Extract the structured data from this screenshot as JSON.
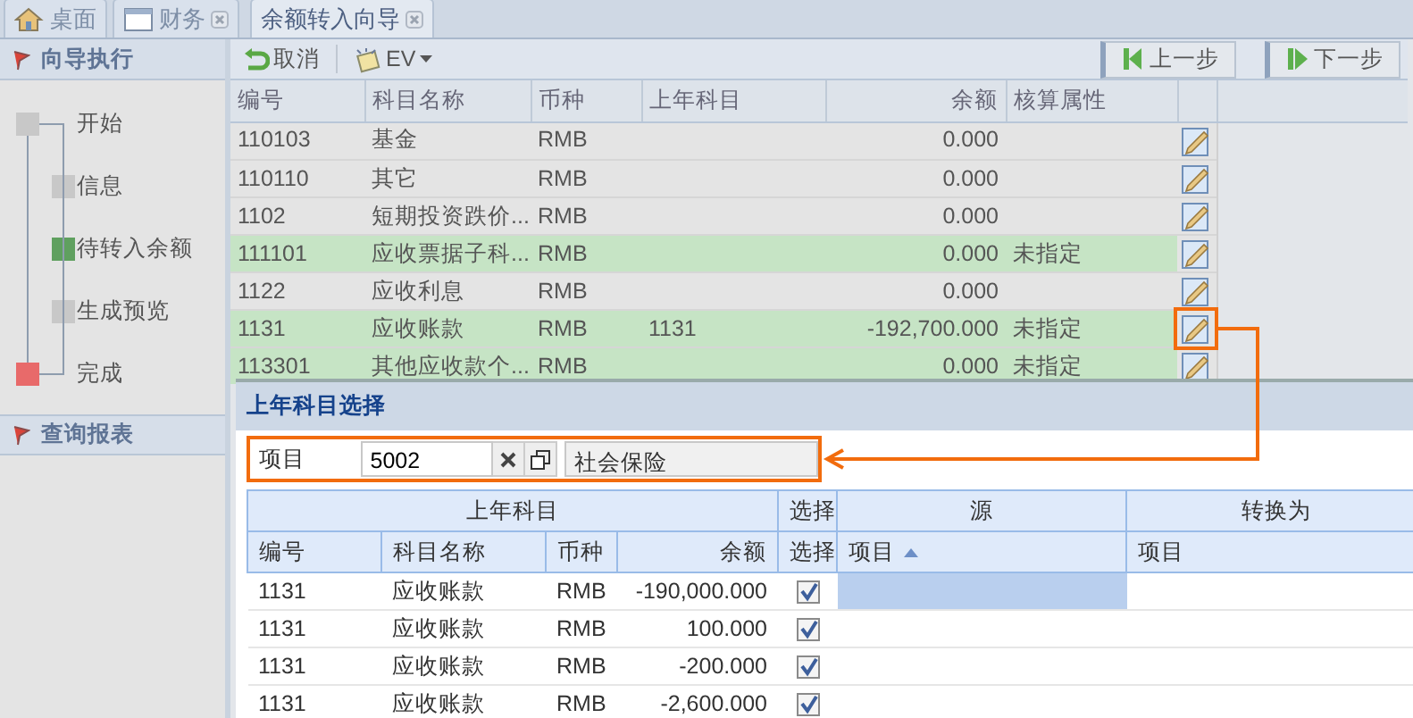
{
  "tabs": [
    {
      "label": "桌面",
      "kind": "desktop",
      "closable": false,
      "selected": false
    },
    {
      "label": "财务",
      "kind": "module",
      "closable": true,
      "selected": false
    },
    {
      "label": "余额转入向导",
      "kind": "wizard",
      "closable": true,
      "selected": true
    }
  ],
  "wizard_panel": {
    "title": "向导执行",
    "steps": [
      {
        "label": "开始",
        "color": "#c8c8c8",
        "children": [
          {
            "label": "信息",
            "color": "#c8c8c8"
          },
          {
            "label": "待转入余额",
            "color": "#5fa05f"
          },
          {
            "label": "生成预览",
            "color": "#c8c8c8"
          }
        ]
      },
      {
        "label": "完成",
        "color": "#e86a6a"
      }
    ]
  },
  "report_panel": {
    "title": "查询报表"
  },
  "toolbar": {
    "cancel": "取消",
    "ev": "EV",
    "prev": "上一步",
    "next": "下一步"
  },
  "grid": {
    "columns": [
      "编号",
      "科目名称",
      "币种",
      "上年科目",
      "余额",
      "核算属性"
    ],
    "rows": [
      {
        "code": "110103",
        "name": "基金",
        "currency": "RMB",
        "prev_account": "",
        "balance": "0.000",
        "attribute": "",
        "highlighted": false,
        "marked": false
      },
      {
        "code": "110110",
        "name": "其它",
        "currency": "RMB",
        "prev_account": "",
        "balance": "0.000",
        "attribute": "",
        "highlighted": false,
        "marked": false
      },
      {
        "code": "1102",
        "name": "短期投资跌价...",
        "currency": "RMB",
        "prev_account": "",
        "balance": "0.000",
        "attribute": "",
        "highlighted": false,
        "marked": false
      },
      {
        "code": "111101",
        "name": "应收票据子科...",
        "currency": "RMB",
        "prev_account": "",
        "balance": "0.000",
        "attribute": "未指定",
        "highlighted": true,
        "marked": false
      },
      {
        "code": "1122",
        "name": "应收利息",
        "currency": "RMB",
        "prev_account": "",
        "balance": "0.000",
        "attribute": "",
        "highlighted": false,
        "marked": false
      },
      {
        "code": "1131",
        "name": "应收账款",
        "currency": "RMB",
        "prev_account": "1131",
        "balance": "-192,700.000",
        "attribute": "未指定",
        "highlighted": true,
        "marked": true
      },
      {
        "code": "113301",
        "name": "其他应收款个...",
        "currency": "RMB",
        "prev_account": "",
        "balance": "0.000",
        "attribute": "未指定",
        "highlighted": true,
        "marked": false
      }
    ]
  },
  "dialog": {
    "title": "上年科目选择",
    "filter": {
      "label": "项目",
      "value": "5002",
      "name": "社会保险",
      "marked": true
    },
    "group_headers": [
      "上年科目",
      "选择",
      "源",
      "转换为"
    ],
    "columns": [
      {
        "label": "编号"
      },
      {
        "label": "科目名称"
      },
      {
        "label": "币种"
      },
      {
        "label": "余额"
      },
      {
        "label": "选择"
      },
      {
        "label": "项目",
        "sorted": true
      },
      {
        "label": "项目"
      }
    ],
    "rows": [
      {
        "code": "1131",
        "name": "应收账款",
        "currency": "RMB",
        "balance": "-190,000.000",
        "checked": true,
        "selected": true
      },
      {
        "code": "1131",
        "name": "应收账款",
        "currency": "RMB",
        "balance": "100.000",
        "checked": true,
        "selected": false
      },
      {
        "code": "1131",
        "name": "应收账款",
        "currency": "RMB",
        "balance": "-200.000",
        "checked": true,
        "selected": false
      },
      {
        "code": "1131",
        "name": "应收账款",
        "currency": "RMB",
        "balance": "-2,600.000",
        "checked": true,
        "selected": false
      }
    ]
  }
}
